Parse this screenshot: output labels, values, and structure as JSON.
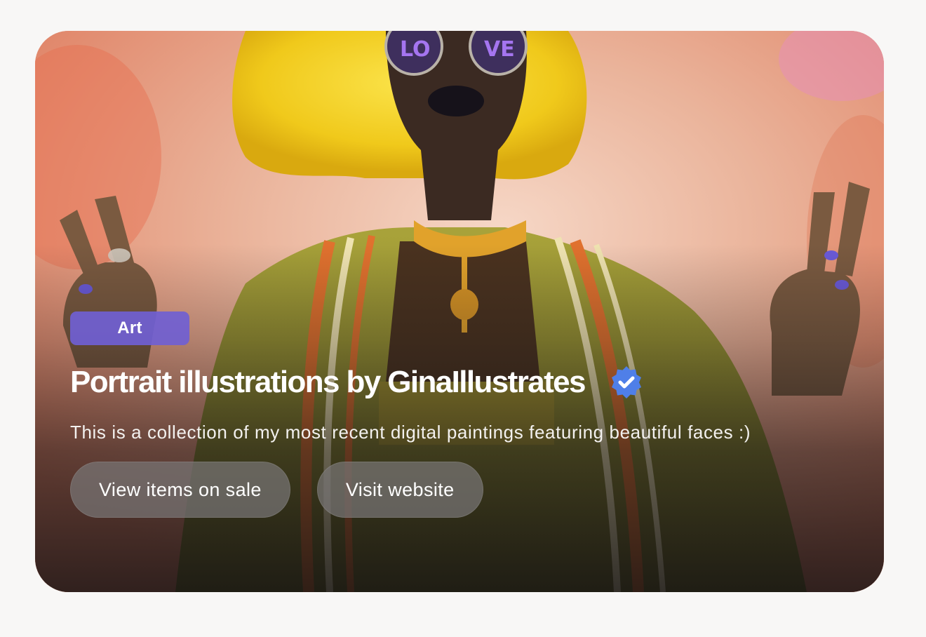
{
  "collection": {
    "category_tag": "Art",
    "title": "Portrait illustrations by GinaIllustrates",
    "verified_icon": "verified-badge-icon",
    "description": "This is a collection of my most recent digital paintings featuring beautiful faces :)",
    "sunglasses_lettering": "LOVE"
  },
  "actions": {
    "view_items_label": "View items on sale",
    "visit_website_label": "Visit website"
  },
  "colors": {
    "page_background": "#f8f7f6",
    "tag_background": "#7060d2",
    "verified_badge": "#4f7fe8",
    "button_background": "#787676",
    "hair_yellow": "#f1cd1f",
    "nail_purple": "#6a5ad8"
  }
}
